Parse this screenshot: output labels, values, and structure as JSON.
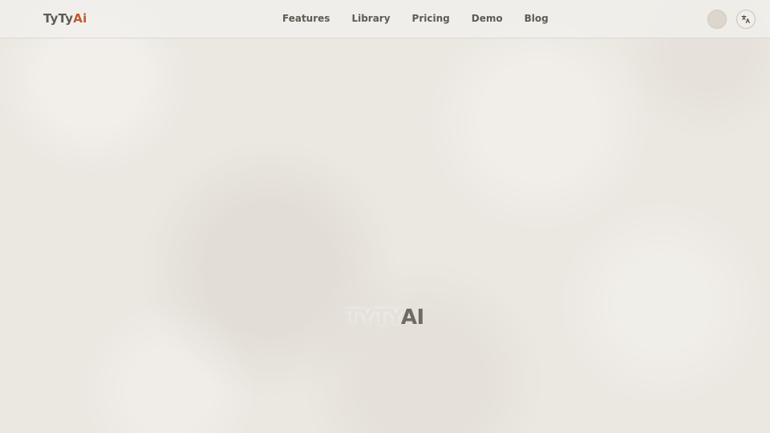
{
  "header": {
    "logo": {
      "part1": "TyTy",
      "part2": "Ai"
    },
    "nav": [
      {
        "label": "Features"
      },
      {
        "label": "Library"
      },
      {
        "label": "Pricing"
      },
      {
        "label": "Demo"
      },
      {
        "label": "Blog"
      }
    ],
    "avatar_icon": "avatar-circle",
    "language_icon": "translate-icon"
  },
  "main": {
    "loader_logo": {
      "faded": "TYTY",
      "strong": "AI"
    }
  },
  "colors": {
    "background": "#ebe7e1",
    "text": "#5f5a54",
    "accent": "#c05a2c"
  }
}
